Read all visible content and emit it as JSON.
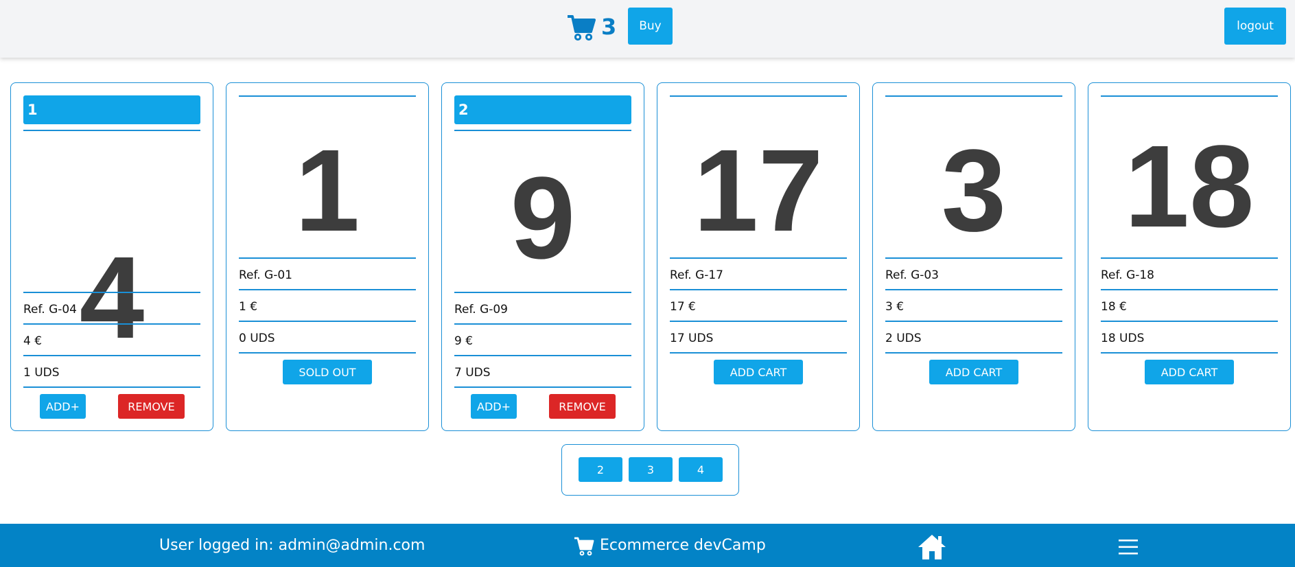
{
  "header": {
    "cart_icon": "cart-icon",
    "cart_count": "3",
    "buy_label": "Buy",
    "logout_label": "logout"
  },
  "products": [
    {
      "qty": "1",
      "number": "4",
      "ref": "Ref. G-04",
      "price": "4 €",
      "stock": "1 UDS",
      "in_cart": true,
      "add_label": "ADD+",
      "remove_label": "REMOVE"
    },
    {
      "qty": "",
      "number": "1",
      "ref": "Ref. G-01",
      "price": "1 €",
      "stock": "0 UDS",
      "in_cart": false,
      "action_label": "SOLD OUT"
    },
    {
      "qty": "2",
      "number": "9",
      "ref": "Ref. G-09",
      "price": "9 €",
      "stock": "7 UDS",
      "in_cart": true,
      "add_label": "ADD+",
      "remove_label": "REMOVE"
    },
    {
      "qty": "",
      "number": "17",
      "ref": "Ref. G-17",
      "price": "17 €",
      "stock": "17 UDS",
      "in_cart": false,
      "action_label": "ADD CART"
    },
    {
      "qty": "",
      "number": "3",
      "ref": "Ref. G-03",
      "price": "3 €",
      "stock": "2 UDS",
      "in_cart": false,
      "action_label": "ADD CART"
    },
    {
      "qty": "",
      "number": "18",
      "ref": "Ref. G-18",
      "price": "18 €",
      "stock": "18 UDS",
      "in_cart": false,
      "action_label": "ADD CART"
    }
  ],
  "pagination": {
    "pages": [
      "2",
      "3",
      "4"
    ]
  },
  "footer": {
    "user_text": "User logged in: admin@admin.com",
    "brand_text": "Ecommerce devCamp",
    "home_icon": "home-icon",
    "menu_icon": "menu-icon"
  },
  "colors": {
    "accent": "#10a5e8",
    "border": "#1a8fd6",
    "danger": "#dc2626",
    "footer_bg": "#0383c6"
  }
}
